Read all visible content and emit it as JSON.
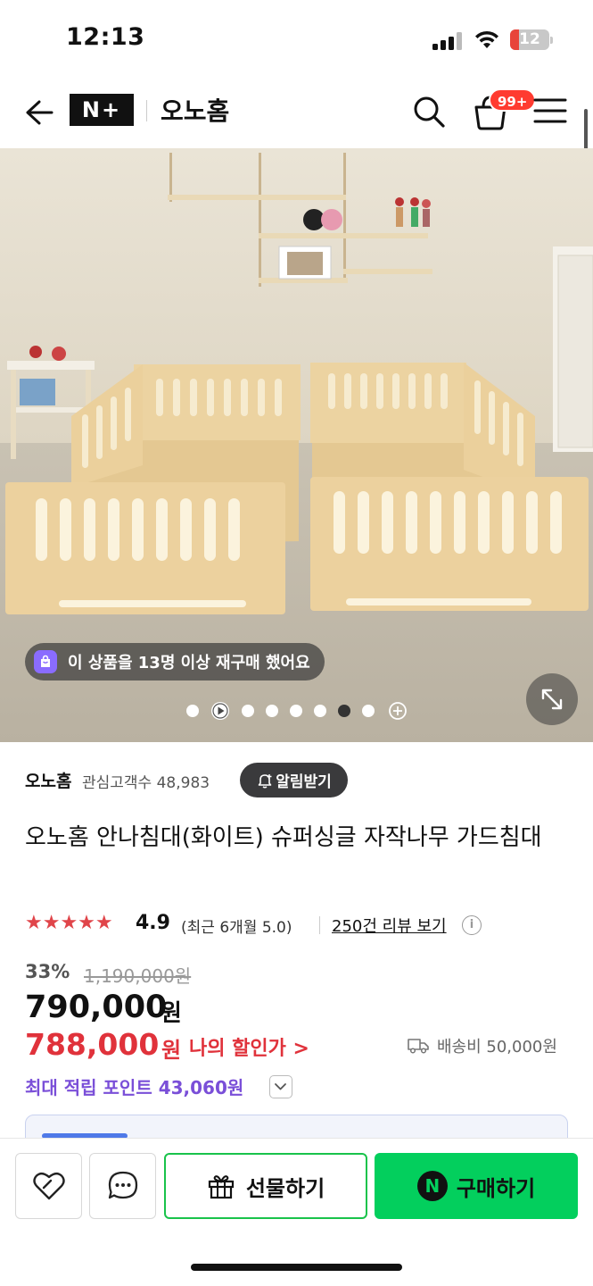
{
  "status_bar": {
    "time": "12:13",
    "battery_level": "12",
    "battery_color": "#e8443a"
  },
  "header": {
    "logo_text": "N+",
    "store_name": "오노홈",
    "cart_badge": "99+",
    "icons": [
      "back-arrow-icon",
      "search-icon",
      "cart-icon",
      "menu-icon"
    ]
  },
  "hero": {
    "repurchase_text": "이 상품을 13명 이상 재구매 했어요",
    "carousel": {
      "total_items": 8,
      "active_index": 5,
      "video_index": 1
    }
  },
  "seller": {
    "name": "오노홈",
    "follower_label": "관심고객수 48,983",
    "alarm_button": "알림받기"
  },
  "product": {
    "title": "오노홈 안나침대(화이트) 슈퍼싱글 자작나무 가드침대"
  },
  "rating": {
    "stars": "★★★★★",
    "value": "4.9",
    "recent": "(최근 6개월 5.0)",
    "review_link": "250건 리뷰 보기",
    "info_icon": "i"
  },
  "price": {
    "discount_rate": "33%",
    "original_price": "1,190,000원",
    "sale_price": "790,000",
    "sale_unit": "원",
    "my_price": "788,000",
    "my_price_unit": "원",
    "my_discount_link": "나의 할인가 >",
    "shipping": "배송비 50,000원",
    "points": "최대 적립 포인트 43,060원"
  },
  "bottom_bar": {
    "gift_label": "선물하기",
    "buy_label": "구매하기",
    "npay_mark": "N"
  },
  "colors": {
    "accent_green": "#03cf5d",
    "price_red": "#e0323b",
    "points_purple": "#7a4fd8",
    "star_red": "#e0454a"
  }
}
